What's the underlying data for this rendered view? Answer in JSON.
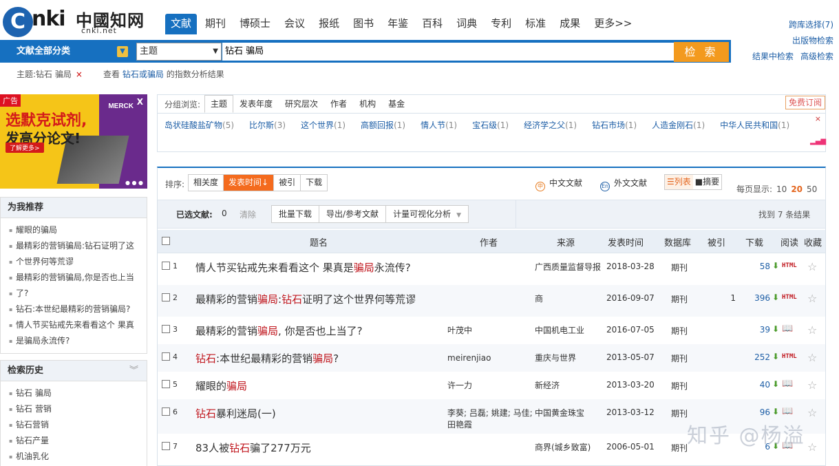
{
  "brand": {
    "logo_mark": "C",
    "logo_text": "nki",
    "logo_cn": "中國知网",
    "logo_domain": "cnki.net"
  },
  "nav_tabs": [
    {
      "label": "文献",
      "active": true
    },
    {
      "label": "期刊"
    },
    {
      "label": "博硕士"
    },
    {
      "label": "会议"
    },
    {
      "label": "报纸"
    },
    {
      "label": "图书"
    },
    {
      "label": "年鉴"
    },
    {
      "label": "百科"
    },
    {
      "label": "词典"
    },
    {
      "label": "专利"
    },
    {
      "label": "标准"
    },
    {
      "label": "成果"
    },
    {
      "label": "更多>>"
    }
  ],
  "top_links": {
    "cross": "跨库选择(7)",
    "publications": "出版物检索",
    "within": "结果中检索",
    "advanced": "高级检索"
  },
  "search": {
    "category": "文献全部分类",
    "field": "主题",
    "query": "钻石  骗局",
    "button": "检 索"
  },
  "crumb": {
    "text": "主题:钻石 骗局",
    "close": "×"
  },
  "analysis": {
    "prefix": "查看",
    "terms": "钻石或骗局",
    "suffix": "的指数分析结果"
  },
  "ad": {
    "tag": "广告",
    "line1": "选默克试剂,",
    "line2": "发高分论文!",
    "more": "了解更多>",
    "brand": "MERCK",
    "close": "X"
  },
  "recommend": {
    "title": "为我推荐",
    "items": [
      "耀眼的骗局",
      "最精彩的营销骗局:钻石证明了这",
      "个世界何等荒谬",
      "最精彩的营销骗局,你是否也上当",
      "了?",
      "钻石:本世纪最精彩的营销骗局?",
      "情人节买钻戒先来看看这个 果真",
      "是骗局永流传?"
    ]
  },
  "history": {
    "title": "检索历史",
    "items": [
      "钻石 骗局",
      "钻石 营销",
      "钻石营销",
      "钻石产量",
      "机油乳化"
    ]
  },
  "group": {
    "label": "分组浏览:",
    "tabs": [
      {
        "label": "主题",
        "active": true
      },
      {
        "label": "发表年度"
      },
      {
        "label": "研究层次"
      },
      {
        "label": "作者"
      },
      {
        "label": "机构"
      },
      {
        "label": "基金"
      }
    ],
    "subscribe": "免费订阅",
    "close": "×",
    "items": [
      {
        "name": "岛状硅酸盐矿物",
        "count": "(5)"
      },
      {
        "name": "比尔斯",
        "count": "(3)"
      },
      {
        "name": "这个世界",
        "count": "(1)"
      },
      {
        "name": "高额回报",
        "count": "(1)"
      },
      {
        "name": "情人节",
        "count": "(1)"
      },
      {
        "name": "宝石级",
        "count": "(1)"
      },
      {
        "name": "经济学之父",
        "count": "(1)"
      },
      {
        "name": "钻石市场",
        "count": "(1)"
      },
      {
        "name": "人造金刚石",
        "count": "(1)"
      },
      {
        "name": "中华人民共和国",
        "count": "(1)"
      }
    ]
  },
  "sort": {
    "label": "排序:",
    "options": [
      {
        "label": "相关度"
      },
      {
        "label": "发表时间↓",
        "active": true
      },
      {
        "label": "被引"
      },
      {
        "label": "下载"
      }
    ]
  },
  "lang": {
    "zh": "中文文献",
    "en": "外文文献",
    "zh_icon": "中",
    "en_icon": "En"
  },
  "views": [
    {
      "label": "☰列表",
      "active": true
    },
    {
      "label": "■摘要"
    }
  ],
  "perpage": {
    "label": "每页显示:",
    "options": [
      {
        "v": "10"
      },
      {
        "v": "20",
        "active": true
      },
      {
        "v": "50"
      }
    ]
  },
  "selection": {
    "label": "已选文献:",
    "count": "0",
    "clear": "清除",
    "buttons": [
      "批量下载",
      "导出/参考文献",
      "计量可视化分析"
    ],
    "found": "找到 7 条结果"
  },
  "table": {
    "headers": {
      "title": "题名",
      "author": "作者",
      "source": "来源",
      "date": "发表时间",
      "db": "数据库",
      "cited": "被引",
      "downloads": "下载",
      "read": "阅读",
      "fav": "收藏"
    },
    "rows": [
      {
        "no": "1",
        "pre": "情人节买钻戒先来看看这个 果真是",
        "hl": "骗局",
        "post": "永流传?",
        "hl0": "",
        "mid": "",
        "author": "",
        "source": "广西质量监督导报",
        "date": "2018-03-28",
        "db": "期刊",
        "cited": "",
        "dl": "58",
        "read": "HTML"
      },
      {
        "no": "2",
        "pre": "最精彩的营销",
        "hl": "骗局",
        "post": "证明了这个世界何等荒谬",
        "hl0": "",
        "mid": ":",
        "hl2": "钻石",
        "author": "",
        "source": "商",
        "date": "2016-09-07",
        "db": "期刊",
        "cited": "1",
        "dl": "396",
        "read": "HTML"
      },
      {
        "no": "3",
        "pre": "最精彩的营销",
        "hl": "骗局",
        "post": ", 你是否也上当了?",
        "author": "叶茂中",
        "source": "中国机电工业",
        "date": "2016-07-05",
        "db": "期刊",
        "cited": "",
        "dl": "39",
        "read": "book"
      },
      {
        "no": "4",
        "hl0": "钻石",
        "pre": ":本世纪最精彩的营销",
        "hl": "骗局",
        "post": "?",
        "author": "meirenjiao",
        "source": "重庆与世界",
        "date": "2013-05-07",
        "db": "期刊",
        "cited": "",
        "dl": "252",
        "read": "HTML"
      },
      {
        "no": "5",
        "pre": "耀眼的",
        "hl": "骗局",
        "post": "",
        "author": "许一力",
        "source": "新经济",
        "date": "2013-03-20",
        "db": "期刊",
        "cited": "",
        "dl": "40",
        "read": "book"
      },
      {
        "no": "6",
        "hl0": "钻石",
        "pre": "暴利迷局(一)",
        "hl": "",
        "post": "",
        "author": "李葵; 吕磊; 姚建; 马佳; 田艳霞",
        "source": "中国黄金珠宝",
        "date": "2013-03-12",
        "db": "期刊",
        "cited": "",
        "dl": "96",
        "read": "book"
      },
      {
        "no": "7",
        "pre": "83人被",
        "hl": "钻石",
        "post": "骗了277万元",
        "author": "",
        "source": "商界(城乡致富)",
        "date": "2006-05-01",
        "db": "期刊",
        "cited": "",
        "dl": "6",
        "read": "book"
      }
    ]
  },
  "watermark": "知乎 @杨溢"
}
